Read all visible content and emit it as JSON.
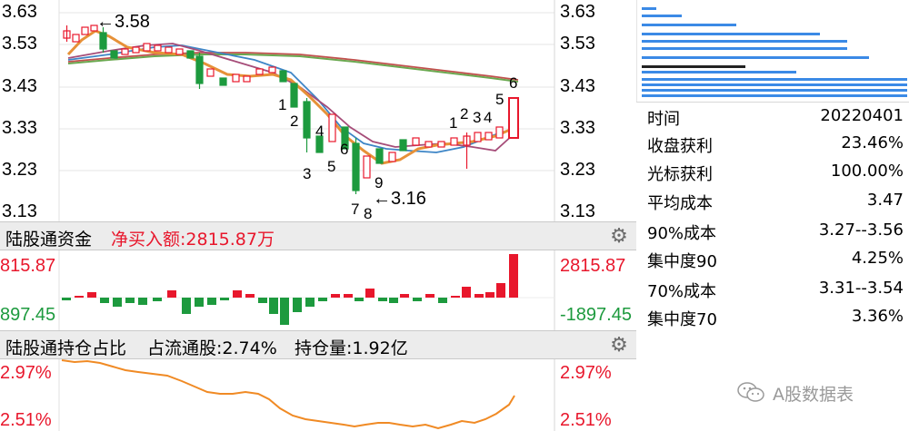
{
  "price_panel": {
    "y_ticks_left": [
      "3.63",
      "3.53",
      "3.43",
      "3.33",
      "3.23",
      "3.13"
    ],
    "y_ticks_right": [
      "3.63",
      "3.53",
      "3.43",
      "3.33",
      "3.23",
      "3.13"
    ],
    "high_marker": "←3.58",
    "low_marker": "←3.16",
    "candle_numbers": [
      "1",
      "2",
      "3",
      "4",
      "5",
      "6",
      "7",
      "8",
      "9",
      "1",
      "2",
      "3",
      "4",
      "5",
      "6"
    ]
  },
  "flow_panel": {
    "title": "陆股通资金",
    "net_buy": "净买入额:2815.87万",
    "left_top": "815.87",
    "left_bottom": "897.45",
    "right_top": "2815.87",
    "right_bottom": "-1897.45",
    "colors": {
      "positive": "#e8172c",
      "negative": "#1d9a3e"
    }
  },
  "holding_panel": {
    "title": "陆股通持仓占比",
    "float_ratio": "占流通股:2.74%",
    "holding": "持仓量:1.92亿",
    "left_top": "2.97%",
    "left_bottom": "2.51%",
    "right_top": "2.97%",
    "right_bottom": "2.51%",
    "line_color": "#f08a24"
  },
  "cost_panel": {
    "rows": [
      {
        "key": "时间",
        "value": "20220401"
      },
      {
        "key": "收盘获利",
        "value": "23.46%"
      },
      {
        "key": "光标获利",
        "value": "100.00%"
      },
      {
        "key": "平均成本",
        "value": "3.47"
      },
      {
        "key": "90%成本",
        "value": "3.27--3.56"
      },
      {
        "key": "集中度90",
        "value": "4.25%"
      },
      {
        "key": "70%成本",
        "value": "3.31--3.54"
      },
      {
        "key": "集中度70",
        "value": "3.36%"
      }
    ]
  },
  "watermark": {
    "text": "A股数据表"
  }
}
